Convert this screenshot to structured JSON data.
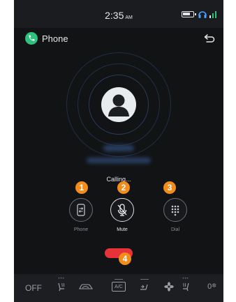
{
  "status_bar": {
    "time": "2:35",
    "ampm": "AM"
  },
  "app": {
    "title": "Phone"
  },
  "call": {
    "status": "Calling..."
  },
  "controls": [
    {
      "label": "Phone",
      "badge": "1",
      "icon": "phone-switch-icon"
    },
    {
      "label": "Mute",
      "badge": "2",
      "icon": "mic-off-icon"
    },
    {
      "label": "Dial",
      "badge": "3",
      "icon": "dialpad-icon"
    }
  ],
  "end_call": {
    "badge": "4",
    "color": "#e8323a"
  },
  "climate": {
    "off_label": "OFF",
    "temp_label": "0",
    "ac_label": "A/C"
  },
  "colors": {
    "accent": "#f28c1a",
    "phone_green": "#2ec27e",
    "end_call_red": "#e8323a",
    "background": "#111315"
  }
}
